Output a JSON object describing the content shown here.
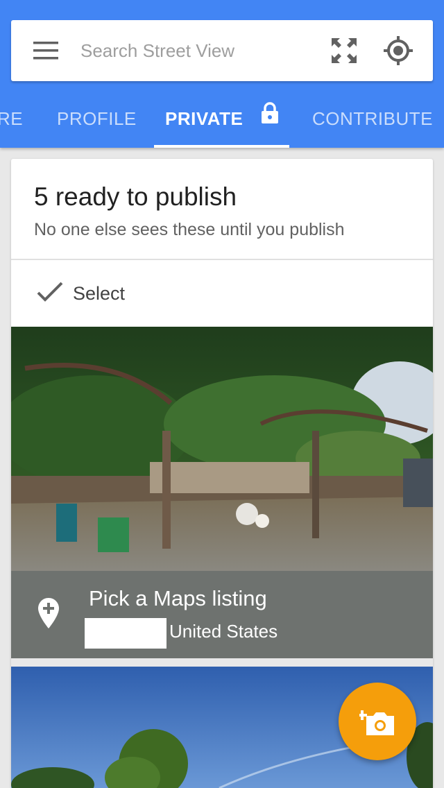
{
  "search": {
    "placeholder": "Search Street View"
  },
  "tabs": [
    {
      "label": "RE"
    },
    {
      "label": "PROFILE"
    },
    {
      "label": "PRIVATE",
      "active": true
    },
    {
      "label": "CONTRIBUTE"
    }
  ],
  "card": {
    "title": "5 ready to publish",
    "subtitle": "No one else sees these until you publish",
    "select_label": "Select"
  },
  "listing": {
    "title": "Pick a Maps listing",
    "country": "United States"
  },
  "colors": {
    "primary": "#4285f4",
    "fab": "#f59e0b",
    "listing_bar": "#6e726f"
  },
  "icons": {
    "menu": "menu-icon",
    "fullscreen": "fullscreen-icon",
    "location": "my-location-icon",
    "lock": "lock-icon",
    "check": "check-icon",
    "pin": "add-location-icon",
    "fab": "add-photo-icon"
  }
}
